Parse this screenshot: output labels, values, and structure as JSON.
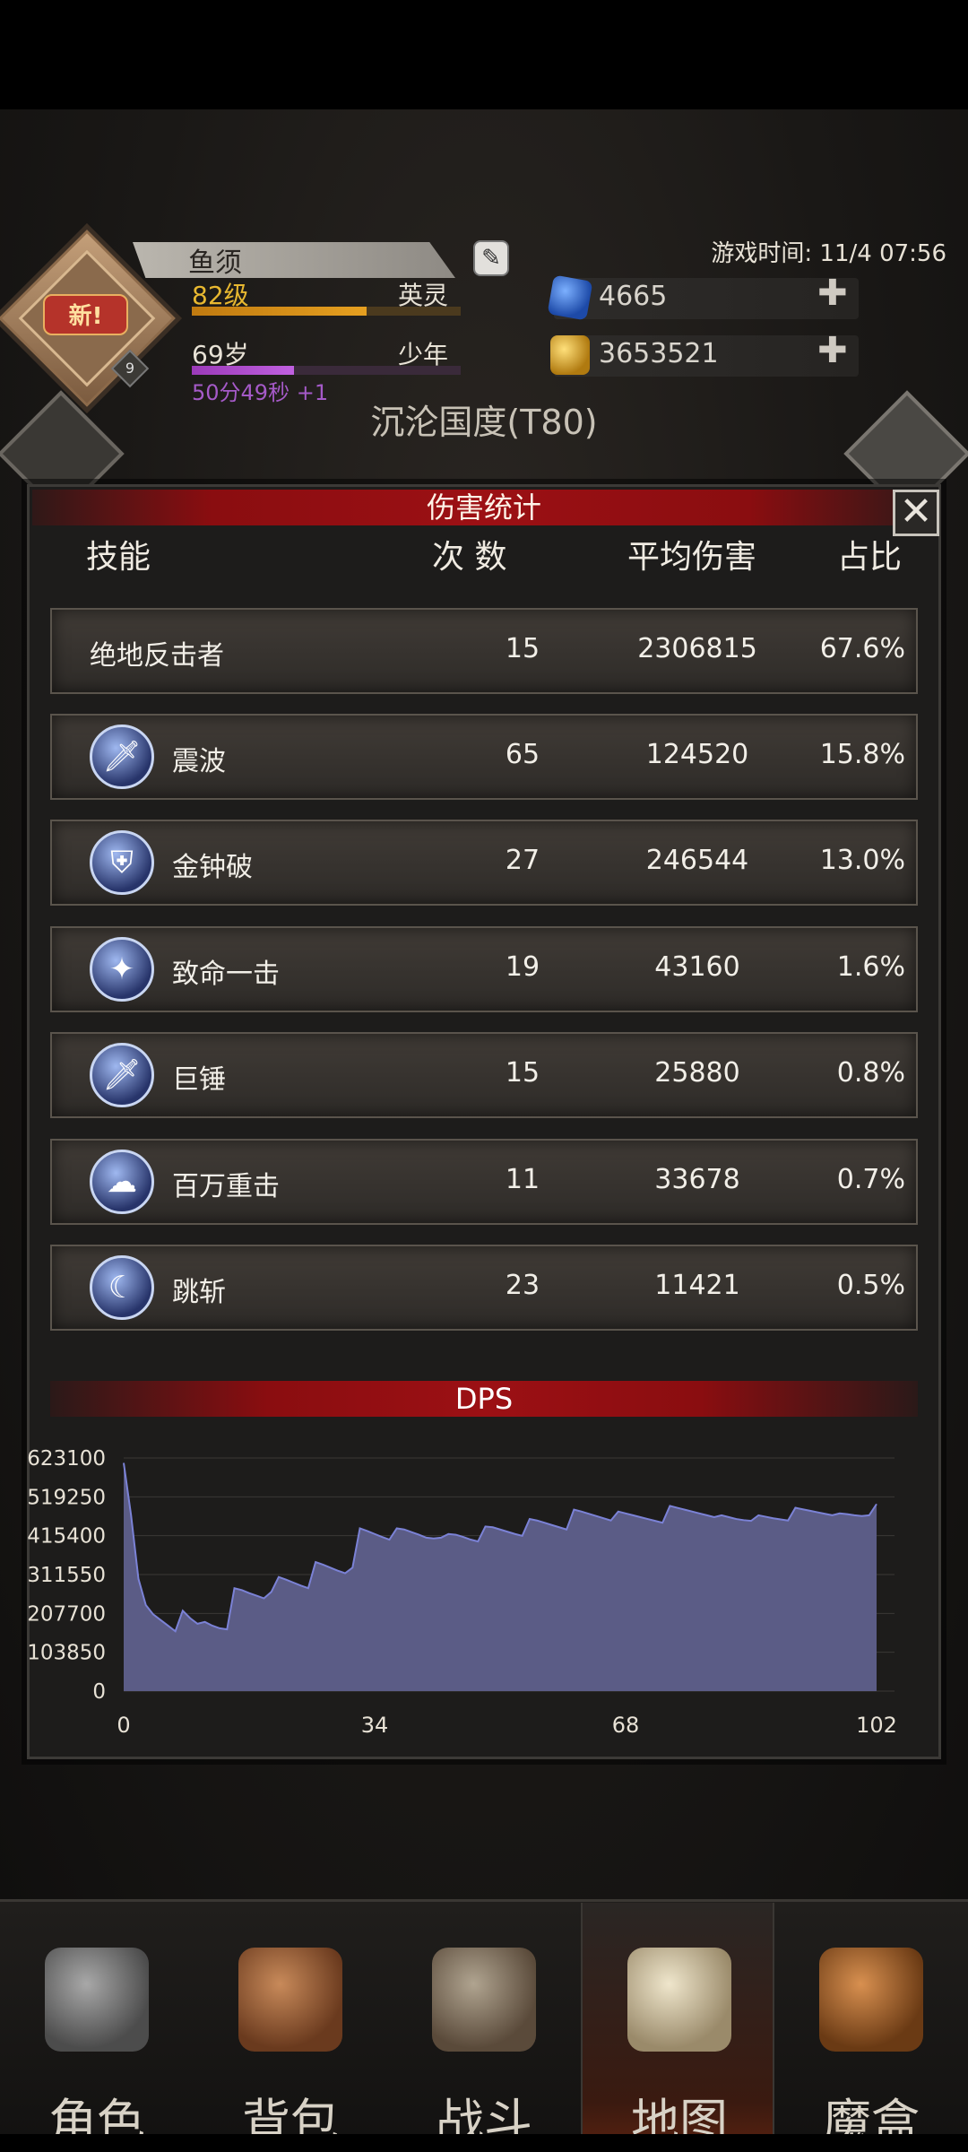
{
  "header": {
    "name": "鱼须",
    "level": "82级",
    "rank": "英灵",
    "level_progress": 0.65,
    "age": "69岁",
    "life_stage": "少年",
    "age_progress": 0.38,
    "timer": "50分49秒 +1",
    "new_badge": "新!",
    "avatar_level": "9",
    "game_time": "游戏时间: 11/4 07:56",
    "gems": "4665",
    "gold": "3653521",
    "region": "沉沦国度(T80)"
  },
  "modal": {
    "title": "伤害统计",
    "columns": {
      "skill": "技能",
      "count": "次 数",
      "avg": "平均伤害",
      "share": "占比"
    },
    "rows": [
      {
        "name": "绝地反击者",
        "count": "15",
        "avg": "2306815",
        "share": "67.6%",
        "icon": "none"
      },
      {
        "name": "震波",
        "count": "65",
        "avg": "124520",
        "share": "15.8%",
        "icon": "sword-icon"
      },
      {
        "name": "金钟破",
        "count": "27",
        "avg": "246544",
        "share": "13.0%",
        "icon": "bell-shield-icon"
      },
      {
        "name": "致命一击",
        "count": "19",
        "avg": "43160",
        "share": "1.6%",
        "icon": "crit-strike-icon"
      },
      {
        "name": "巨锤",
        "count": "15",
        "avg": "25880",
        "share": "0.8%",
        "icon": "sword-icon"
      },
      {
        "name": "百万重击",
        "count": "11",
        "avg": "33678",
        "share": "0.7%",
        "icon": "mushroom-cloud-icon"
      },
      {
        "name": "跳斩",
        "count": "23",
        "avg": "11421",
        "share": "0.5%",
        "icon": "slash-icon"
      }
    ],
    "dps_title": "DPS"
  },
  "chart_data": {
    "type": "area",
    "title": "DPS",
    "xlim": [
      0,
      102
    ],
    "ylim": [
      0,
      623100
    ],
    "xticks": [
      "0",
      "34",
      "68",
      "102"
    ],
    "yticks": [
      "623100",
      "519250",
      "415400",
      "311550",
      "207700",
      "103850",
      "0"
    ],
    "series": [
      {
        "x": [
          0,
          1,
          2,
          3,
          4,
          5,
          6,
          7,
          8,
          9,
          10,
          11,
          12,
          13,
          14,
          15,
          16,
          17,
          18,
          19,
          20,
          21,
          22,
          23,
          24,
          25,
          26,
          27,
          28,
          29,
          30,
          31,
          32,
          33,
          34,
          35,
          36,
          37,
          38,
          39,
          40,
          41,
          42,
          43,
          44,
          45,
          46,
          47,
          48,
          49,
          50,
          51,
          52,
          53,
          54,
          55,
          56,
          57,
          58,
          59,
          60,
          61,
          62,
          63,
          64,
          65,
          66,
          67,
          68,
          69,
          70,
          71,
          72,
          73,
          74,
          75,
          76,
          77,
          78,
          79,
          80,
          81,
          82,
          83,
          84,
          85,
          86,
          87,
          88,
          89,
          90,
          91,
          92,
          93,
          94,
          95,
          96,
          97,
          98,
          99,
          100,
          101,
          102
        ],
        "values": [
          610000,
          470000,
          300000,
          230000,
          205000,
          190000,
          175000,
          160000,
          215000,
          195000,
          180000,
          185000,
          175000,
          168000,
          165000,
          275000,
          270000,
          262000,
          255000,
          248000,
          265000,
          305000,
          298000,
          290000,
          282000,
          275000,
          345000,
          338000,
          330000,
          322000,
          315000,
          330000,
          435000,
          428000,
          420000,
          412000,
          405000,
          435000,
          432000,
          425000,
          418000,
          410000,
          408000,
          410000,
          420000,
          418000,
          412000,
          405000,
          400000,
          440000,
          438000,
          432000,
          426000,
          420000,
          415000,
          460000,
          456000,
          450000,
          444000,
          438000,
          432000,
          485000,
          480000,
          474000,
          468000,
          462000,
          456000,
          480000,
          475000,
          470000,
          465000,
          460000,
          455000,
          450000,
          495000,
          490000,
          485000,
          480000,
          475000,
          470000,
          465000,
          470000,
          465000,
          460000,
          457000,
          455000,
          470000,
          466000,
          462000,
          459000,
          456000,
          490000,
          486000,
          482000,
          478000,
          474000,
          470000,
          475000,
          473000,
          470000,
          468000,
          470000,
          500000
        ]
      }
    ]
  },
  "nav": {
    "items": [
      {
        "label": "角色",
        "icon": "horned-helmet-icon"
      },
      {
        "label": "背包",
        "icon": "backpack-icon"
      },
      {
        "label": "战斗",
        "icon": "shield-sword-icon"
      },
      {
        "label": "地图",
        "icon": "scroll-map-icon"
      },
      {
        "label": "魔盒",
        "icon": "magic-box-icon"
      }
    ],
    "active_index": 3
  },
  "colors": {
    "accent_red": "#9c1014",
    "chart_fill": "#5b5c86",
    "chart_line": "#7b82d6",
    "gold": "#e8b830",
    "purple": "#a55ac8"
  }
}
